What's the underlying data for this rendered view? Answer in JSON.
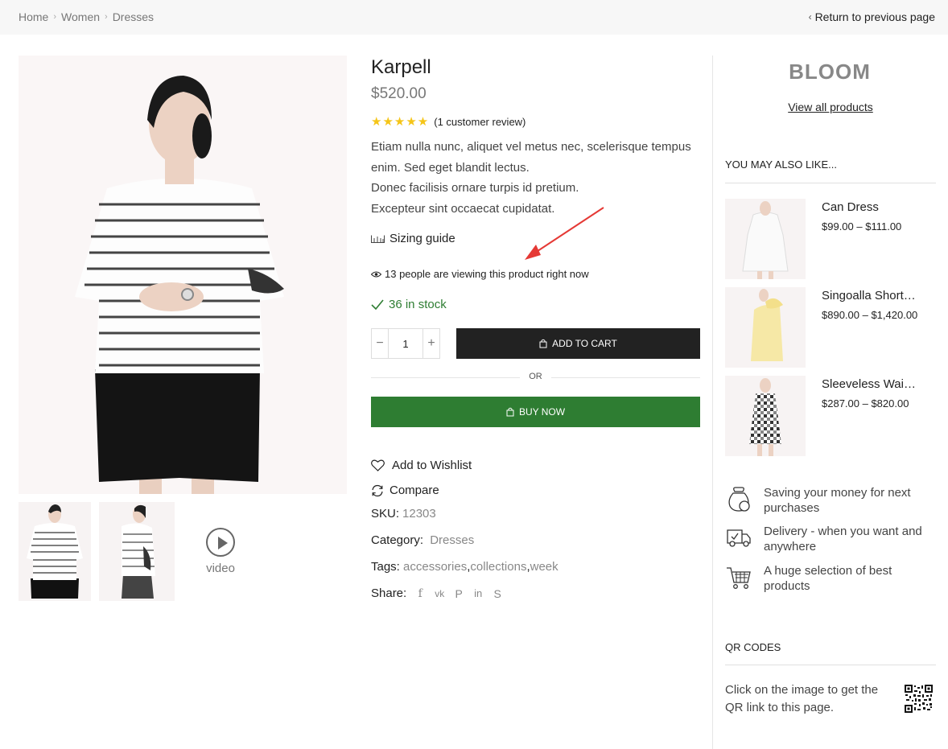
{
  "breadcrumb": {
    "items": [
      "Home",
      "Women",
      "Dresses"
    ],
    "return_label": "Return to previous page"
  },
  "product": {
    "title": "Karpell",
    "price": "$520.00",
    "rating": 5,
    "review_text": "(1 customer review)",
    "description": [
      "Etiam nulla nunc, aliquet vel metus nec, scelerisque tempus enim. Sed eget blandit lectus.",
      "Donec facilisis ornare turpis id pretium.",
      "Excepteur sint occaecat cupidatat."
    ],
    "sizing_guide": "Sizing guide",
    "viewing": "13 people are viewing this product right now",
    "stock": "36 in stock",
    "quantity": "1",
    "add_to_cart": "ADD TO CART",
    "or": "OR",
    "buy_now": "BUY NOW",
    "wishlist": "Add to Wishlist",
    "compare": "Compare",
    "sku_label": "SKU:",
    "sku": "12303",
    "category_label": "Category:",
    "category": "Dresses",
    "tags_label": "Tags:",
    "tags": [
      "accessories",
      "collections",
      "week"
    ],
    "share_label": "Share:",
    "share_icons": [
      "facebook-icon",
      "vk-icon",
      "pinterest-icon",
      "linkedin-icon",
      "skype-icon"
    ]
  },
  "gallery": {
    "video_label": "video"
  },
  "sidebar": {
    "brand": "BLOOM",
    "view_all": "View all products",
    "also_like_heading": "YOU MAY ALSO LIKE...",
    "related": [
      {
        "name": "Can Dress",
        "price": "$99.00 – $111.00"
      },
      {
        "name": "Singoalla Short…",
        "price": "$890.00 – $1,420.00"
      },
      {
        "name": "Sleeveless Wai…",
        "price": "$287.00 – $820.00"
      }
    ],
    "features": [
      "Saving your money for next purchases",
      "Delivery - when you want and anywhere",
      "A huge selection of best products"
    ],
    "qr_heading": "QR CODES",
    "qr_text": "Click on the image to get the QR link to this page."
  },
  "colors": {
    "green": "#2e7d32",
    "dark": "#222222",
    "star": "#f5c518",
    "arrow": "#e53935"
  }
}
